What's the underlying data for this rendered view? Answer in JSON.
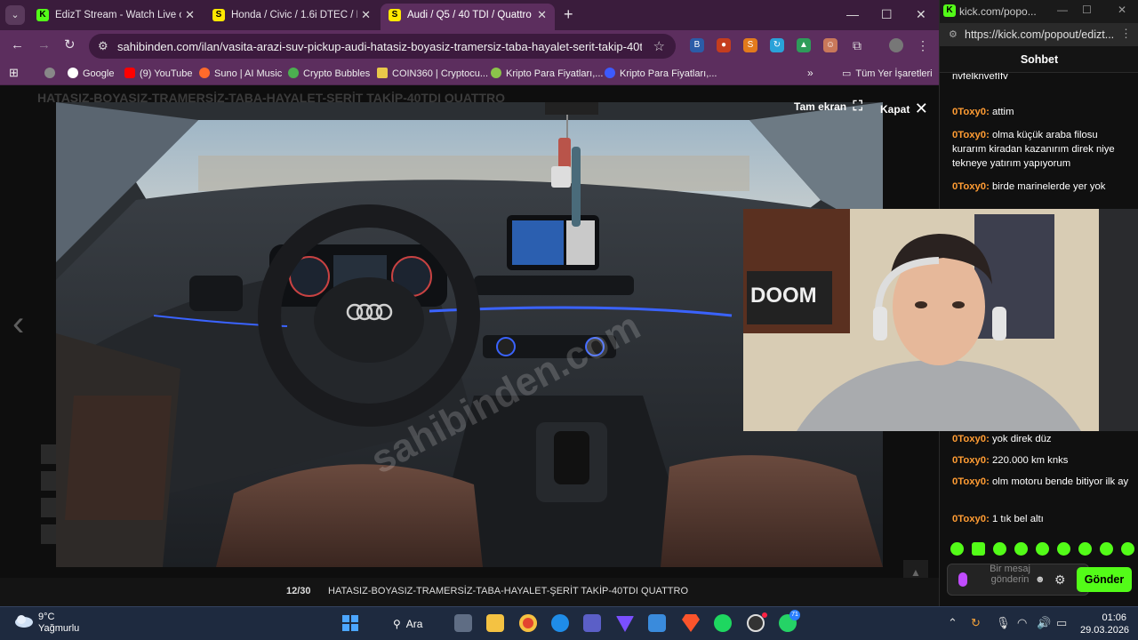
{
  "browser": {
    "tabs": [
      {
        "title": "EdizT Stream - Watch Live on Ki",
        "favicon": "kick-icon"
      },
      {
        "title": "Honda / Civic / 1.6i DTEC / Eleg",
        "favicon": "sahibinden-icon"
      },
      {
        "title": "Audi / Q5 / 40 TDI / Quattro De",
        "favicon": "sahibinden-icon"
      }
    ],
    "url": "sahibinden.com/ilan/vasita-arazi-suv-pickup-audi-hatasiz-boyasiz-tramersiz-taba-hayalet-serit-takip-40tdi-quattr...",
    "bookmarks": [
      "Google",
      "(9) YouTube",
      "Suno | AI Music",
      "Crypto Bubbles",
      "COIN360 | Cryptocu...",
      "Kripto Para Fiyatları,...",
      "Kripto Para Fiyatları,..."
    ],
    "bookmarks_all": "Tüm Yer İşaretleri"
  },
  "page": {
    "bg_title": "HATASIZ-BOYASIZ-TRAMERSİZ-TABA-HAYALET-ŞERİT TAKİP-40TDI QUATTRO",
    "fullscreen_label": "Tam ekran",
    "close_label": "Kapat",
    "counter": "12/30",
    "caption": "HATASIZ-BOYASIZ-TRAMERSİZ-TABA-HAYALET-ŞERİT TAKİP-40TDI QUATTRO",
    "watermark": "sahibinden.com"
  },
  "kick": {
    "window_title": "kick.com/popo...",
    "url": "https://kick.com/popout/edizt...",
    "chat_header": "Sohbet",
    "messages_top": [
      {
        "user": "",
        "text": "nvfelknvefIfv"
      },
      {
        "user": "0Toxy0:",
        "text": "attim"
      },
      {
        "user": "0Toxy0:",
        "text": "olma küçük araba filosu kurarım kiradan kazanırım direk niye tekneye yatırım yapıyorum"
      },
      {
        "user": "0Toxy0:",
        "text": "birde marinelerde yer yok"
      }
    ],
    "messages_bottom": [
      {
        "user": "0Toxy0:",
        "text": "yok direk düz"
      },
      {
        "user": "0Toxy0:",
        "text": "220.000 km knks"
      },
      {
        "user": "0Toxy0:",
        "text": "olm motoru bende bitiyor ilk ay"
      },
      {
        "user": "0Toxy0:",
        "text": "1 tık bel altı"
      }
    ],
    "input_placeholder": "Bir mesaj gönderin",
    "send_label": "Gönder"
  },
  "taskbar": {
    "temp": "9°C",
    "condition": "Yağmurlu",
    "search_label": "Ara",
    "time": "01:06",
    "date": "29.03.2026",
    "whatsapp_badge": "71"
  },
  "colors": {
    "kick_green": "#53fc18",
    "username_orange": "#ff9c33",
    "browser_theme": "#5c2e5e"
  }
}
